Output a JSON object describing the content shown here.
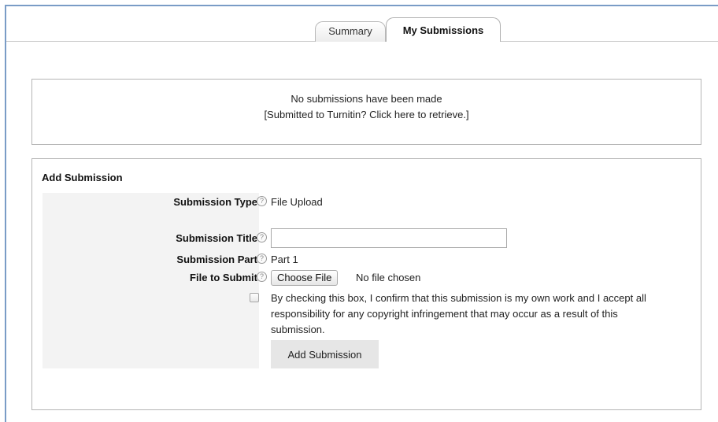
{
  "tabs": [
    {
      "label": "Summary",
      "active": false
    },
    {
      "label": "My Submissions",
      "active": true
    }
  ],
  "notice": {
    "line1": "No submissions have been made",
    "line2": "[Submitted to Turnitin? Click here to retrieve.]"
  },
  "add_submission": {
    "title": "Add Submission",
    "fields": {
      "type": {
        "label": "Submission Type",
        "value": "File Upload"
      },
      "title": {
        "label": "Submission Title",
        "value": ""
      },
      "part": {
        "label": "Submission Part",
        "value": "Part 1"
      },
      "file": {
        "label": "File to Submit",
        "button": "Choose File",
        "status": "No file chosen"
      }
    },
    "help_glyph": "?",
    "confirm_text": "By checking this box, I confirm that this submission is my own work and I accept all responsibility for any copyright infringement that may occur as a result of this submission.",
    "confirm_checked": false,
    "submit_label": "Add Submission"
  },
  "colors": {
    "frame_accent": "#7a9cc6",
    "form_label_bg": "#f3f3f3",
    "button_bg": "#e6e6e6"
  }
}
